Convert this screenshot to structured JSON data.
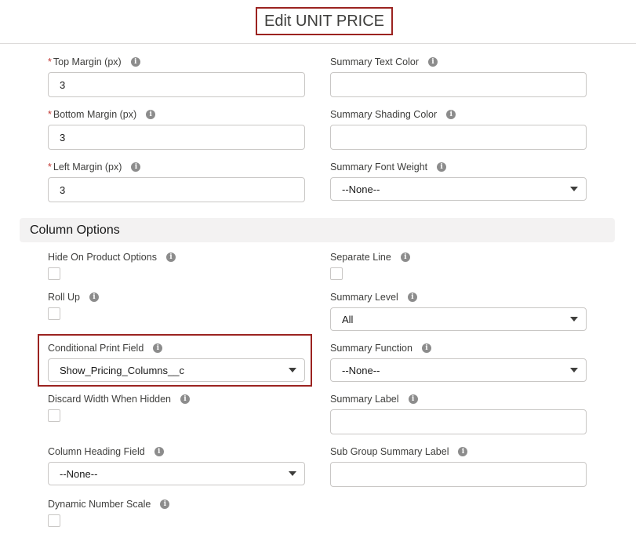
{
  "header": {
    "title": "Edit UNIT PRICE"
  },
  "colors": {
    "highlight": "#9b2320",
    "required": "#c23934",
    "section_bg": "#f3f2f2"
  },
  "margins": {
    "top": {
      "label": "Top Margin (px)",
      "value": "3",
      "required": true
    },
    "bottom": {
      "label": "Bottom Margin (px)",
      "value": "3",
      "required": true
    },
    "left": {
      "label": "Left Margin (px)",
      "value": "3",
      "required": true
    }
  },
  "summary_text_color": {
    "label": "Summary Text Color",
    "value": ""
  },
  "summary_shading_color": {
    "label": "Summary Shading Color",
    "value": ""
  },
  "summary_font_weight": {
    "label": "Summary Font Weight",
    "value": "--None--"
  },
  "section": {
    "title": "Column Options"
  },
  "hide_on_product_options": {
    "label": "Hide On Product Options",
    "checked": false
  },
  "separate_line": {
    "label": "Separate Line",
    "checked": false
  },
  "roll_up": {
    "label": "Roll Up",
    "checked": false
  },
  "summary_level": {
    "label": "Summary Level",
    "value": "All"
  },
  "conditional_print_field": {
    "label": "Conditional Print Field",
    "value": "Show_Pricing_Columns__c"
  },
  "summary_function": {
    "label": "Summary Function",
    "value": "--None--"
  },
  "discard_width_when_hidden": {
    "label": "Discard Width When Hidden",
    "checked": false
  },
  "summary_label": {
    "label": "Summary Label",
    "value": ""
  },
  "column_heading_field": {
    "label": "Column Heading Field",
    "value": "--None--"
  },
  "sub_group_summary_label": {
    "label": "Sub Group Summary Label",
    "value": ""
  },
  "dynamic_number_scale": {
    "label": "Dynamic Number Scale",
    "checked": false
  },
  "required_marker": "*",
  "info_glyph": "i"
}
